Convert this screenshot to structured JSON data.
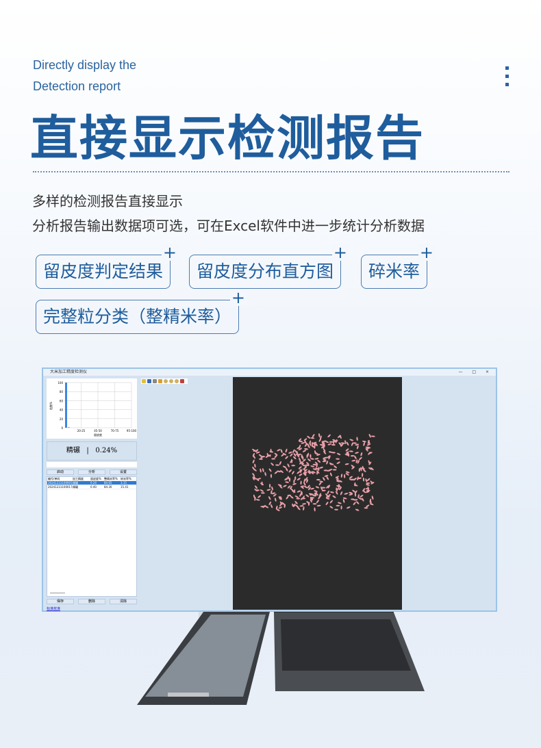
{
  "header": {
    "subtitle_lines": [
      "Directly display the",
      "Detection report"
    ],
    "title": "直接显示检测报告",
    "menu_icon": "vertical-dots-icon"
  },
  "description": [
    "多样的检测报告直接显示",
    "分析报告输出数据项可选，可在Excel软件中进一步统计分析数据"
  ],
  "tags": [
    {
      "label": "留皮度判定结果"
    },
    {
      "label": "留皮度分布直方图"
    },
    {
      "label": "碎米率"
    },
    {
      "label": "完整粒分类（整精米率）"
    }
  ],
  "colors": {
    "accent": "#1f5d9c",
    "bar": "#3b86e0",
    "selected_row": "#2b7bd6",
    "grain": "#e8a0a8"
  },
  "software": {
    "window_title": "大米加工精度检测仪",
    "window_controls": "— □ ×",
    "chart_data": {
      "type": "bar",
      "xlabel": "留皮度",
      "ylabel": "粒数%",
      "ylim": [
        0,
        100
      ],
      "yticks": [
        "100",
        "80",
        "60",
        "40",
        "20",
        "0"
      ],
      "xtick_labels": [
        "20-25",
        "45-50",
        "70-75",
        "95-100"
      ],
      "values": [
        100,
        1
      ]
    },
    "result": {
      "grade": "精碾",
      "separator": "|",
      "value": "0.24%"
    },
    "top_buttons": [
      "启动",
      "分析",
      "设置"
    ],
    "table": {
      "headers": [
        "编号/单码",
        "加工精度",
        "留皮度%",
        "整精米率%",
        "碎米率%"
      ],
      "rows": [
        [
          "20241231100001",
          "精碾",
          "0.24",
          "84.65",
          "3.15"
        ],
        [
          "20241231100017",
          "精碾",
          "0.40",
          "84.30",
          "15.41"
        ]
      ]
    },
    "bottom_buttons": [
      "保存",
      "删除",
      "清除"
    ],
    "link": "标准校准"
  }
}
